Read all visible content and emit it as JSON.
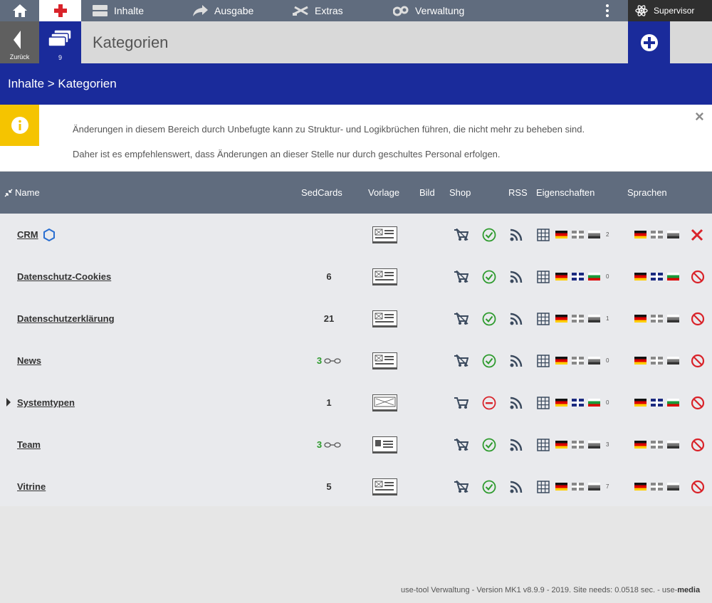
{
  "nav": {
    "items": [
      {
        "label": "Inhalte",
        "icon": "list-icon"
      },
      {
        "label": "Ausgabe",
        "icon": "share-arrow-icon"
      },
      {
        "label": "Extras",
        "icon": "tools-icon"
      },
      {
        "label": "Verwaltung",
        "icon": "gears-icon"
      }
    ],
    "user": "Supervisor"
  },
  "toolbar": {
    "back_label": "Zurück",
    "categories_count": "9",
    "title": "Kategorien"
  },
  "breadcrumb": "Inhalte > Kategorien",
  "info": {
    "line1": "Änderungen in diesem Bereich durch Unbefugte kann zu Struktur- und Logikbrüchen führen, die nicht mehr zu beheben sind.",
    "line2": "Daher ist es empfehlenswert, dass Änderungen an dieser Stelle nur durch geschultes Personal erfolgen.",
    "close": "×"
  },
  "table": {
    "headers": {
      "name": "Name",
      "sedcards": "SedCards",
      "vorlage": "Vorlage",
      "bild": "Bild",
      "shop": "Shop",
      "rss": "RSS",
      "eigenschaften": "Eigenschaften",
      "sprachen": "Sprachen"
    },
    "rows": [
      {
        "name": "CRM",
        "sedcards": "",
        "linked": false,
        "num": "2",
        "status": "ok",
        "shop": "off",
        "eig_uk_color": false,
        "eig_third": "gray",
        "spr_uk_color": false,
        "spr_third": "gray",
        "action": "delete-red"
      },
      {
        "name": "Datenschutz-Cookies",
        "sedcards": "6",
        "linked": false,
        "num": "0",
        "status": "ok",
        "shop": "off",
        "eig_uk_color": true,
        "eig_third": "bg",
        "spr_uk_color": true,
        "spr_third": "bg",
        "action": "forbidden"
      },
      {
        "name": "Datenschutzerklärung",
        "sedcards": "21",
        "linked": false,
        "num": "1",
        "status": "ok",
        "shop": "off",
        "eig_uk_color": false,
        "eig_third": "gray",
        "spr_uk_color": false,
        "spr_third": "gray",
        "action": "forbidden"
      },
      {
        "name": "News",
        "sedcards": "3",
        "linked": true,
        "num": "0",
        "status": "ok",
        "shop": "off",
        "eig_uk_color": false,
        "eig_third": "gray",
        "spr_uk_color": false,
        "spr_third": "gray",
        "action": "forbidden"
      },
      {
        "name": "Systemtypen",
        "sedcards": "1",
        "linked": false,
        "num": "0",
        "status": "blocked",
        "shop": "on",
        "eig_uk_color": true,
        "eig_third": "bg",
        "spr_uk_color": true,
        "spr_third": "bg",
        "action": "forbidden",
        "expandable": true
      },
      {
        "name": "Team",
        "sedcards": "3",
        "linked": true,
        "num": "3",
        "status": "ok",
        "shop": "off",
        "eig_uk_color": false,
        "eig_third": "gray",
        "spr_uk_color": false,
        "spr_third": "gray",
        "action": "forbidden"
      },
      {
        "name": "Vitrine",
        "sedcards": "5",
        "linked": false,
        "num": "7",
        "status": "ok",
        "shop": "off",
        "eig_uk_color": false,
        "eig_third": "gray",
        "spr_uk_color": false,
        "spr_third": "gray",
        "action": "forbidden"
      }
    ]
  },
  "footer": {
    "text": "use-tool Verwaltung - Version MK1 v8.9.9 - 2019. Site needs: 0.0518 sec. - use-",
    "brand": "media"
  },
  "colors": {
    "brand_blue": "#1a2b9b",
    "nav_gray": "#606c7e",
    "warning_yellow": "#f5c400",
    "ok_green": "#2e9b2e",
    "danger_red": "#d9232a"
  }
}
